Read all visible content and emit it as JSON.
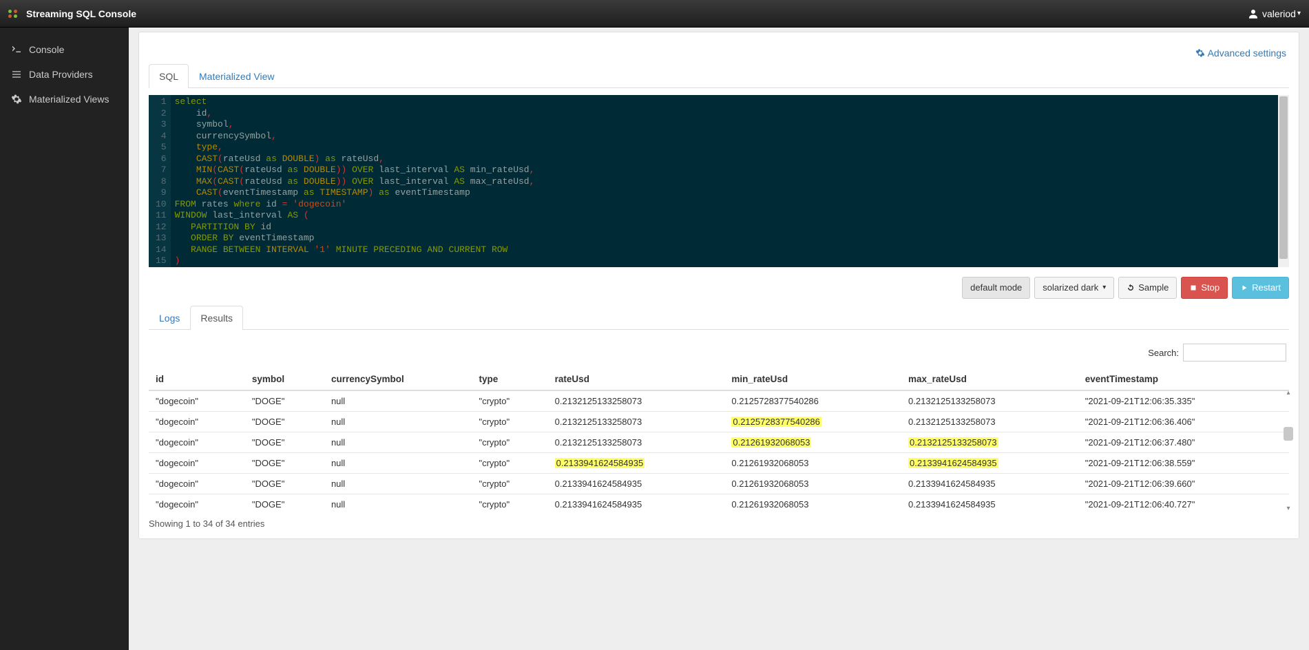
{
  "header": {
    "app_title": "Streaming SQL Console",
    "user_name": "valeriod"
  },
  "sidebar": {
    "items": [
      {
        "label": "Console"
      },
      {
        "label": "Data Providers"
      },
      {
        "label": "Materialized Views"
      }
    ]
  },
  "advanced_settings_label": "Advanced settings",
  "editor_tabs": [
    {
      "label": "SQL"
    },
    {
      "label": "Materialized View"
    }
  ],
  "toolbar": {
    "mode_button": "default mode",
    "theme_button": "solarized dark",
    "sample_button": "Sample",
    "stop_button": "Stop",
    "restart_button": "Restart"
  },
  "result_tabs": [
    {
      "label": "Logs"
    },
    {
      "label": "Results"
    }
  ],
  "search_label": "Search:",
  "columns": [
    "id",
    "symbol",
    "currencySymbol",
    "type",
    "rateUsd",
    "min_rateUsd",
    "max_rateUsd",
    "eventTimestamp"
  ],
  "rows": [
    {
      "id": "\"dogecoin\"",
      "symbol": "\"DOGE\"",
      "currencySymbol": "null",
      "type": "\"crypto\"",
      "rateUsd": "0.2132125133258073",
      "min_rateUsd": "0.2125728377540286",
      "max_rateUsd": "0.2132125133258073",
      "eventTimestamp": "\"2021-09-21T12:06:35.335\"",
      "hl": {}
    },
    {
      "id": "\"dogecoin\"",
      "symbol": "\"DOGE\"",
      "currencySymbol": "null",
      "type": "\"crypto\"",
      "rateUsd": "0.2132125133258073",
      "min_rateUsd": "0.2125728377540286",
      "max_rateUsd": "0.2132125133258073",
      "eventTimestamp": "\"2021-09-21T12:06:36.406\"",
      "hl": {
        "min_rateUsd": true
      }
    },
    {
      "id": "\"dogecoin\"",
      "symbol": "\"DOGE\"",
      "currencySymbol": "null",
      "type": "\"crypto\"",
      "rateUsd": "0.2132125133258073",
      "min_rateUsd": "0.21261932068053",
      "max_rateUsd": "0.2132125133258073",
      "eventTimestamp": "\"2021-09-21T12:06:37.480\"",
      "hl": {
        "min_rateUsd": true,
        "max_rateUsd": true
      }
    },
    {
      "id": "\"dogecoin\"",
      "symbol": "\"DOGE\"",
      "currencySymbol": "null",
      "type": "\"crypto\"",
      "rateUsd": "0.2133941624584935",
      "min_rateUsd": "0.21261932068053",
      "max_rateUsd": "0.2133941624584935",
      "eventTimestamp": "\"2021-09-21T12:06:38.559\"",
      "hl": {
        "rateUsd": true,
        "max_rateUsd": true
      }
    },
    {
      "id": "\"dogecoin\"",
      "symbol": "\"DOGE\"",
      "currencySymbol": "null",
      "type": "\"crypto\"",
      "rateUsd": "0.2133941624584935",
      "min_rateUsd": "0.21261932068053",
      "max_rateUsd": "0.2133941624584935",
      "eventTimestamp": "\"2021-09-21T12:06:39.660\"",
      "hl": {}
    },
    {
      "id": "\"dogecoin\"",
      "symbol": "\"DOGE\"",
      "currencySymbol": "null",
      "type": "\"crypto\"",
      "rateUsd": "0.2133941624584935",
      "min_rateUsd": "0.21261932068053",
      "max_rateUsd": "0.2133941624584935",
      "eventTimestamp": "\"2021-09-21T12:06:40.727\"",
      "hl": {}
    }
  ],
  "footer_info": "Showing 1 to 34 of 34 entries",
  "sql_lines": [
    [
      {
        "t": "select",
        "c": "kw"
      }
    ],
    [
      {
        "t": "    id",
        "c": "plain"
      },
      {
        "t": ",",
        "c": "op"
      }
    ],
    [
      {
        "t": "    symbol",
        "c": "plain"
      },
      {
        "t": ",",
        "c": "op"
      }
    ],
    [
      {
        "t": "    currencySymbol",
        "c": "plain"
      },
      {
        "t": ",",
        "c": "op"
      }
    ],
    [
      {
        "t": "    ",
        "c": "plain"
      },
      {
        "t": "type",
        "c": "fn"
      },
      {
        "t": ",",
        "c": "op"
      }
    ],
    [
      {
        "t": "    ",
        "c": "plain"
      },
      {
        "t": "CAST",
        "c": "fn"
      },
      {
        "t": "(",
        "c": "op"
      },
      {
        "t": "rateUsd ",
        "c": "plain"
      },
      {
        "t": "as",
        "c": "kw"
      },
      {
        "t": " DOUBLE",
        "c": "fn"
      },
      {
        "t": ")",
        "c": "op"
      },
      {
        "t": " as",
        "c": "kw"
      },
      {
        "t": " rateUsd",
        "c": "plain"
      },
      {
        "t": ",",
        "c": "op"
      }
    ],
    [
      {
        "t": "    ",
        "c": "plain"
      },
      {
        "t": "MIN",
        "c": "fn"
      },
      {
        "t": "(",
        "c": "op"
      },
      {
        "t": "CAST",
        "c": "fn"
      },
      {
        "t": "(",
        "c": "op"
      },
      {
        "t": "rateUsd ",
        "c": "plain"
      },
      {
        "t": "as",
        "c": "kw"
      },
      {
        "t": " DOUBLE",
        "c": "fn"
      },
      {
        "t": "))",
        "c": "op"
      },
      {
        "t": " OVER",
        "c": "kw"
      },
      {
        "t": " last_interval ",
        "c": "plain"
      },
      {
        "t": "AS",
        "c": "kw"
      },
      {
        "t": " min_rateUsd",
        "c": "plain"
      },
      {
        "t": ",",
        "c": "op"
      }
    ],
    [
      {
        "t": "    ",
        "c": "plain"
      },
      {
        "t": "MAX",
        "c": "fn"
      },
      {
        "t": "(",
        "c": "op"
      },
      {
        "t": "CAST",
        "c": "fn"
      },
      {
        "t": "(",
        "c": "op"
      },
      {
        "t": "rateUsd ",
        "c": "plain"
      },
      {
        "t": "as",
        "c": "kw"
      },
      {
        "t": " DOUBLE",
        "c": "fn"
      },
      {
        "t": "))",
        "c": "op"
      },
      {
        "t": " OVER",
        "c": "kw"
      },
      {
        "t": " last_interval ",
        "c": "plain"
      },
      {
        "t": "AS",
        "c": "kw"
      },
      {
        "t": " max_rateUsd",
        "c": "plain"
      },
      {
        "t": ",",
        "c": "op"
      }
    ],
    [
      {
        "t": "    ",
        "c": "plain"
      },
      {
        "t": "CAST",
        "c": "fn"
      },
      {
        "t": "(",
        "c": "op"
      },
      {
        "t": "eventTimestamp ",
        "c": "plain"
      },
      {
        "t": "as",
        "c": "kw"
      },
      {
        "t": " TIMESTAMP",
        "c": "fn"
      },
      {
        "t": ")",
        "c": "op"
      },
      {
        "t": " as",
        "c": "kw"
      },
      {
        "t": " eventTimestamp",
        "c": "plain"
      }
    ],
    [
      {
        "t": "FROM",
        "c": "kw"
      },
      {
        "t": " rates ",
        "c": "plain"
      },
      {
        "t": "where",
        "c": "kw"
      },
      {
        "t": " id ",
        "c": "plain"
      },
      {
        "t": "=",
        "c": "op"
      },
      {
        "t": " ",
        "c": "plain"
      },
      {
        "t": "'dogecoin'",
        "c": "str"
      }
    ],
    [
      {
        "t": "WINDOW",
        "c": "kw"
      },
      {
        "t": " last_interval ",
        "c": "plain"
      },
      {
        "t": "AS",
        "c": "kw"
      },
      {
        "t": " ",
        "c": "plain"
      },
      {
        "t": "(",
        "c": "op"
      }
    ],
    [
      {
        "t": "   ",
        "c": "plain"
      },
      {
        "t": "PARTITION BY",
        "c": "kw"
      },
      {
        "t": " id",
        "c": "plain"
      }
    ],
    [
      {
        "t": "   ",
        "c": "plain"
      },
      {
        "t": "ORDER BY",
        "c": "kw"
      },
      {
        "t": " eventTimestamp",
        "c": "plain"
      }
    ],
    [
      {
        "t": "   ",
        "c": "plain"
      },
      {
        "t": "RANGE BETWEEN",
        "c": "kw"
      },
      {
        "t": " ",
        "c": "plain"
      },
      {
        "t": "INTERVAL",
        "c": "fn"
      },
      {
        "t": " ",
        "c": "plain"
      },
      {
        "t": "'1'",
        "c": "str"
      },
      {
        "t": " ",
        "c": "plain"
      },
      {
        "t": "MINUTE PRECEDING AND CURRENT ROW",
        "c": "kw"
      }
    ],
    [
      {
        "t": ")",
        "c": "op"
      }
    ]
  ]
}
